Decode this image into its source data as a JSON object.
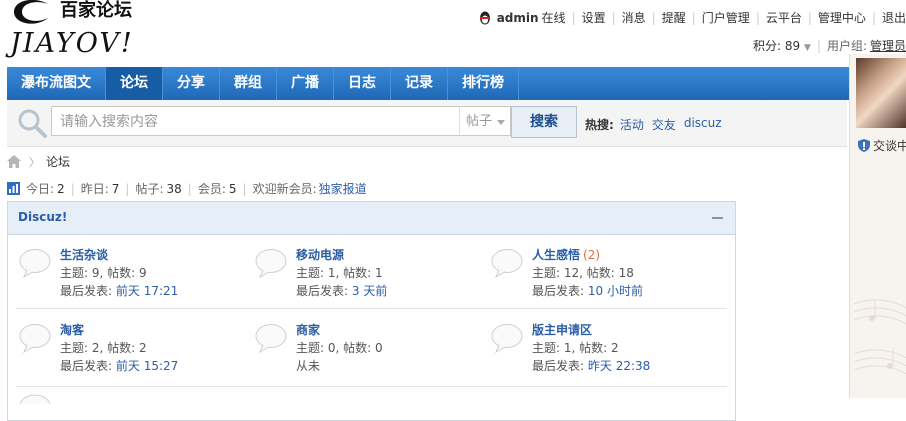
{
  "header": {
    "logo_cn": "百家论坛",
    "logo_en": "JIAYOV!",
    "user": {
      "username": "admin",
      "status": "在线",
      "links": [
        "设置",
        "消息",
        "提醒",
        "门户管理",
        "云平台",
        "管理中心",
        "退出"
      ],
      "points_label": "积分: 89",
      "usergroup_label": "用户组:",
      "usergroup_value": "管理员"
    }
  },
  "nav": {
    "items": [
      "瀑布流图文",
      "论坛",
      "分享",
      "群组",
      "广播",
      "日志",
      "记录",
      "排行榜"
    ],
    "active": "论坛"
  },
  "search": {
    "placeholder": "请输入搜索内容",
    "type": "帖子",
    "button": "搜索",
    "hot_label": "热搜:",
    "hot_words": [
      "活动",
      "交友",
      "discuz"
    ]
  },
  "breadcrumb": {
    "current": "论坛"
  },
  "stats": {
    "today_label": "今日:",
    "today": "2",
    "yesterday_label": "昨日:",
    "yesterday": "7",
    "posts_label": "帖子:",
    "posts": "38",
    "members_label": "会员:",
    "members": "5",
    "newmember_label": "欢迎新会员:",
    "newmember": "独家报道"
  },
  "forum_group": {
    "title": "Discuz!",
    "forums": [
      {
        "name": "生活杂谈",
        "new": "",
        "stats": "主题: 9, 帖数: 9",
        "last_label": "最后发表:",
        "last_time": "前天 17:21"
      },
      {
        "name": "移动电源",
        "new": "",
        "stats": "主题: 1, 帖数: 1",
        "last_label": "最后发表:",
        "last_time": "3 天前"
      },
      {
        "name": "人生感悟",
        "new": "(2)",
        "stats": "主题: 12, 帖数: 18",
        "last_label": "最后发表:",
        "last_time": "10 小时前"
      },
      {
        "name": "淘客",
        "new": "",
        "stats": "主题: 2, 帖数: 2",
        "last_label": "最后发表:",
        "last_time": "前天 15:27"
      },
      {
        "name": "商家",
        "new": "",
        "stats": "主题: 0, 帖数: 0",
        "last_label": "从未",
        "last_time": ""
      },
      {
        "name": "版主申请区",
        "new": "",
        "stats": "主题: 1, 帖数: 2",
        "last_label": "最后发表:",
        "last_time": "昨天 22:38"
      }
    ]
  },
  "sidebar": {
    "chat_label": "交谈中"
  },
  "colors": {
    "nav_bg": "#2b7acd",
    "link": "#2b5ea8",
    "accent_new": "#e06c3c"
  }
}
